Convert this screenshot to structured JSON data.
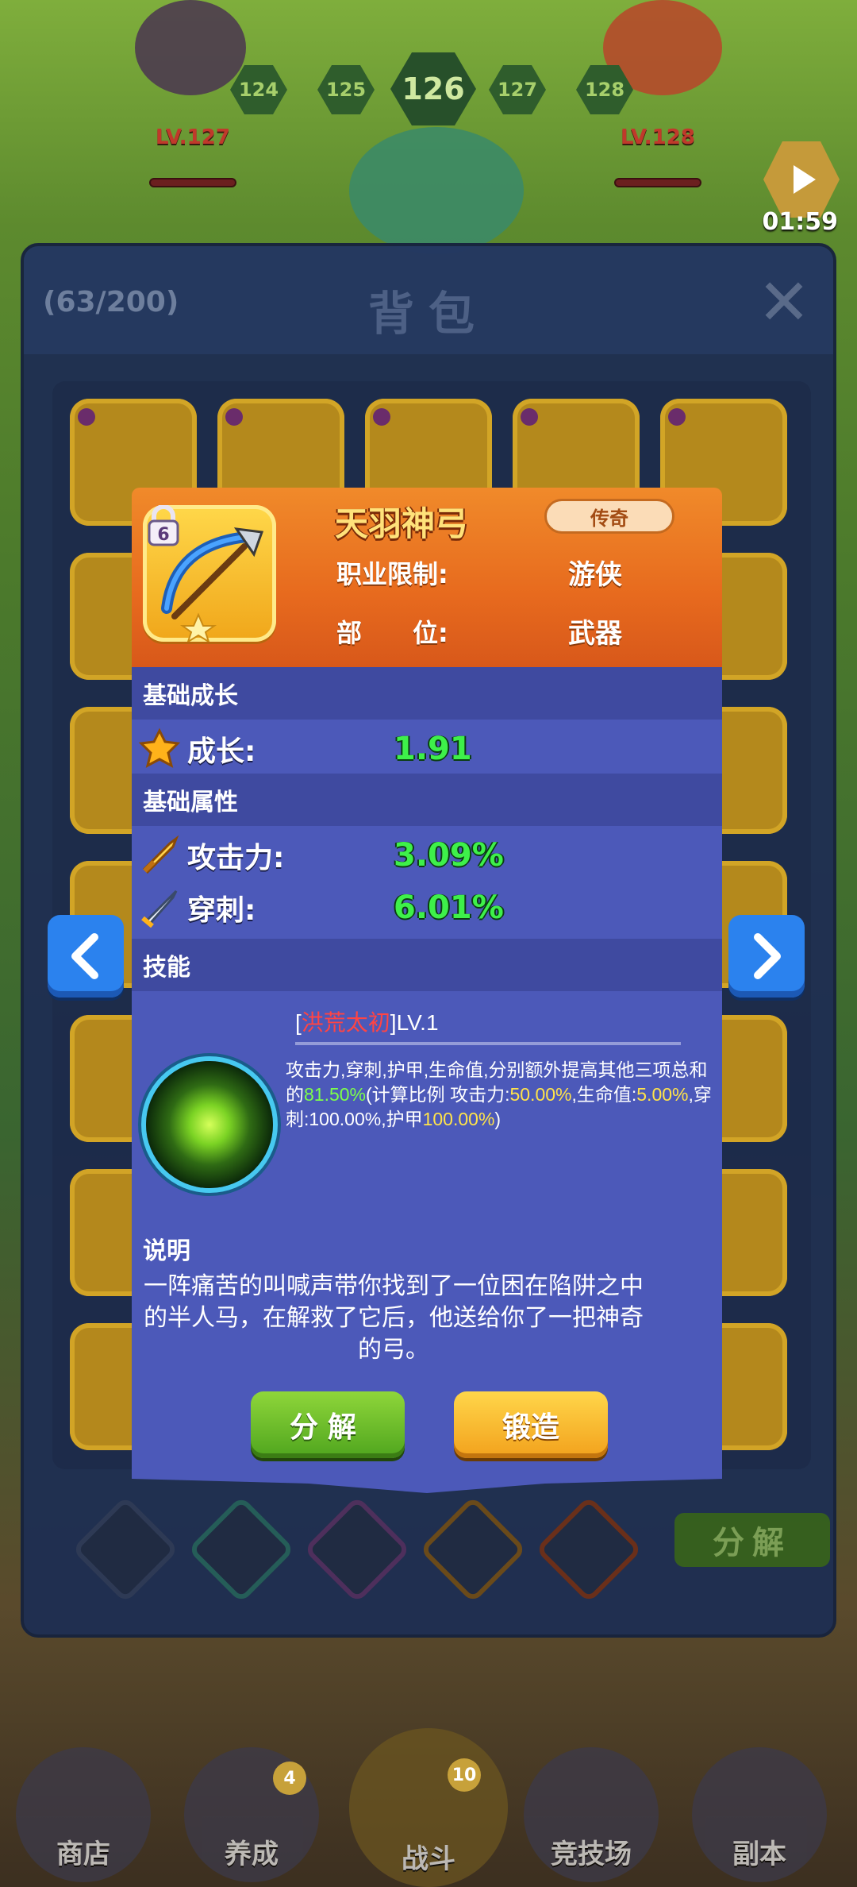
{
  "battle": {
    "stages": [
      "124",
      "125",
      "126",
      "127",
      "128"
    ],
    "left_level": "LV.127",
    "right_level": "LV.128",
    "timer": "01:59"
  },
  "bag": {
    "count": "(63/200)",
    "title": "背包",
    "close_glyph": "✕",
    "decompose_label": "分解"
  },
  "item": {
    "name": "天羽神弓",
    "rarity": "传奇",
    "lock_level": "6",
    "class_label": "职业限制:",
    "class_value": "游侠",
    "slot_label": "部　　位:",
    "slot_value": "武器",
    "growth_section": "基础成长",
    "growth_label": "成长:",
    "growth_value": "1.91",
    "attr_section": "基础属性",
    "attack_label": "攻击力:",
    "attack_value": "3.09%",
    "pierce_label": "穿刺:",
    "pierce_value": "6.01%",
    "skill_section": "技能",
    "skill_bracket_open": "[",
    "skill_name": "洪荒太初",
    "skill_level": "]LV.1",
    "skill_desc_1": "攻击力,穿刺,护甲,生命值,分别额外提高其他三项总和的",
    "skill_pct_1": "81.50%",
    "skill_desc_2": "(计算比例 攻击力:",
    "skill_pct_2": "50.00%",
    "skill_desc_3": ",生命值:",
    "skill_pct_3": "5.00%",
    "skill_desc_4": ",穿刺:100.00%,护甲",
    "skill_pct_4": "100.00%",
    "skill_desc_5": ")",
    "desc_section": "说明",
    "description": "一阵痛苦的叫喊声带你找到了一位困在陷阱之中的半人马，在解救了它后，他送给你了一把神奇的弓。",
    "btn_decompose": "分解",
    "btn_forge": "锻造"
  },
  "nav": [
    {
      "label": "商店"
    },
    {
      "label": "养成",
      "badge": "4"
    },
    {
      "label": "战斗",
      "badge": "10"
    },
    {
      "label": "竞技场"
    },
    {
      "label": "副本"
    }
  ],
  "colors": {
    "accent_green": "#3ef04a",
    "card_blue": "#4c59b9",
    "card_orange": "#e76a1e",
    "skill_red": "#ff4444"
  }
}
